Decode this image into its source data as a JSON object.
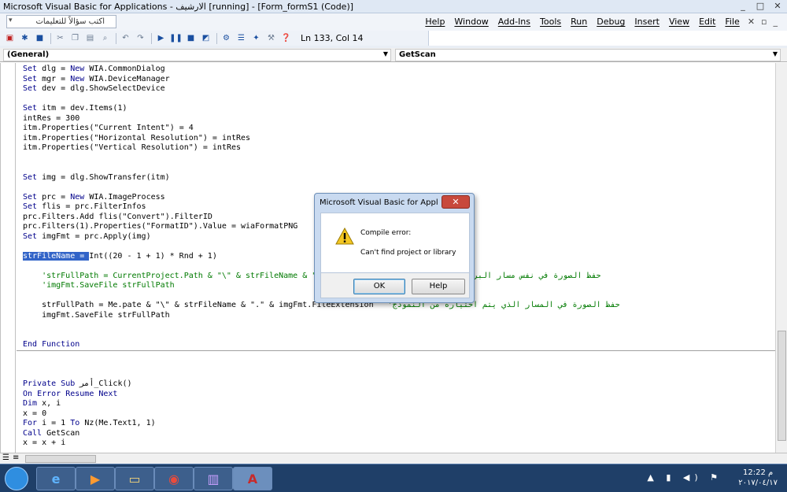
{
  "window": {
    "title": "Microsoft Visual Basic for Applications - الارشيف [running] - [Form_formS1 (Code)]",
    "controls": [
      "_",
      "□",
      "✕"
    ]
  },
  "menubar": {
    "ask_placeholder": "اكتب سؤالاً للتعليمات",
    "items": [
      "Help",
      "Window",
      "Add-Ins",
      "Tools",
      "Run",
      "Debug",
      "Insert",
      "View",
      "Edit",
      "File"
    ],
    "doc_controls": [
      "✕",
      "▫",
      "_"
    ]
  },
  "toolbar": {
    "position": "Ln 133, Col 14"
  },
  "combos": {
    "object": "(General)",
    "procedure": "GetScan"
  },
  "code": {
    "lines": [
      {
        "t": "Set dlg = New WIA.CommonDialog"
      },
      {
        "t": "Set mgr = New WIA.DeviceManager"
      },
      {
        "t": "Set dev = dlg.ShowSelectDevice"
      },
      {
        "t": ""
      },
      {
        "t": "Set itm = dev.Items(1)"
      },
      {
        "t": "intRes = 300"
      },
      {
        "t": "itm.Properties(\"Current Intent\") = 4"
      },
      {
        "t": "itm.Properties(\"Horizontal Resolution\") = intRes"
      },
      {
        "t": "itm.Properties(\"Vertical Resolution\") = intRes"
      },
      {
        "t": ""
      },
      {
        "t": ""
      },
      {
        "t": "Set img = dlg.ShowTransfer(itm)"
      },
      {
        "t": ""
      },
      {
        "t": "Set prc = New WIA.ImageProcess"
      },
      {
        "t": "Set flis = prc.FilterInfos"
      },
      {
        "t": "prc.Filters.Add flis(\"Convert\").FilterID"
      },
      {
        "t": "prc.Filters(1).Properties(\"FormatID\").Value = wiaFormatPNG"
      },
      {
        "t": "Set imgFmt = prc.Apply(img)"
      },
      {
        "t": ""
      },
      {
        "t": "strFileName = Int((20 - 1 + 1) * Rnd + 1)"
      },
      {
        "t": ""
      },
      {
        "t": "    'strFullPath = CurrentProject.Path & \"\\\" & strFileName & \".\" & imgFmt.FileExtension   'حفظ الصورة في نفس مسار البرنامج"
      },
      {
        "t": "    'imgFmt.SaveFile strFullPath"
      },
      {
        "t": ""
      },
      {
        "t": "    strFullPath = Me.pate & \"\\\" & strFileName & \".\" & imgFmt.FileExtension   'حفظ الصورة في المسار الذي يتم اختياره من النموذج"
      },
      {
        "t": "    imgFmt.SaveFile strFullPath"
      },
      {
        "t": ""
      },
      {
        "t": ""
      },
      {
        "t": "End Function"
      },
      {
        "t": ""
      },
      {
        "t": ""
      },
      {
        "t": ""
      },
      {
        "t": "Private Sub أمر_Click()"
      },
      {
        "t": "On Error Resume Next"
      },
      {
        "t": "Dim x, i"
      },
      {
        "t": "x = 0"
      },
      {
        "t": "For i = 1 To Nz(Me.Text1, 1)"
      },
      {
        "t": "Call GetScan"
      },
      {
        "t": "x = x + i"
      }
    ]
  },
  "dialog": {
    "title": "Microsoft Visual Basic for Applications",
    "close": "✕",
    "heading": "Compile error:",
    "message": "Can't find project or library",
    "ok": "OK",
    "help": "Help"
  },
  "taskbar": {
    "time": "12:22 م",
    "date": "٢٠١٧/٠٤/١٧"
  }
}
